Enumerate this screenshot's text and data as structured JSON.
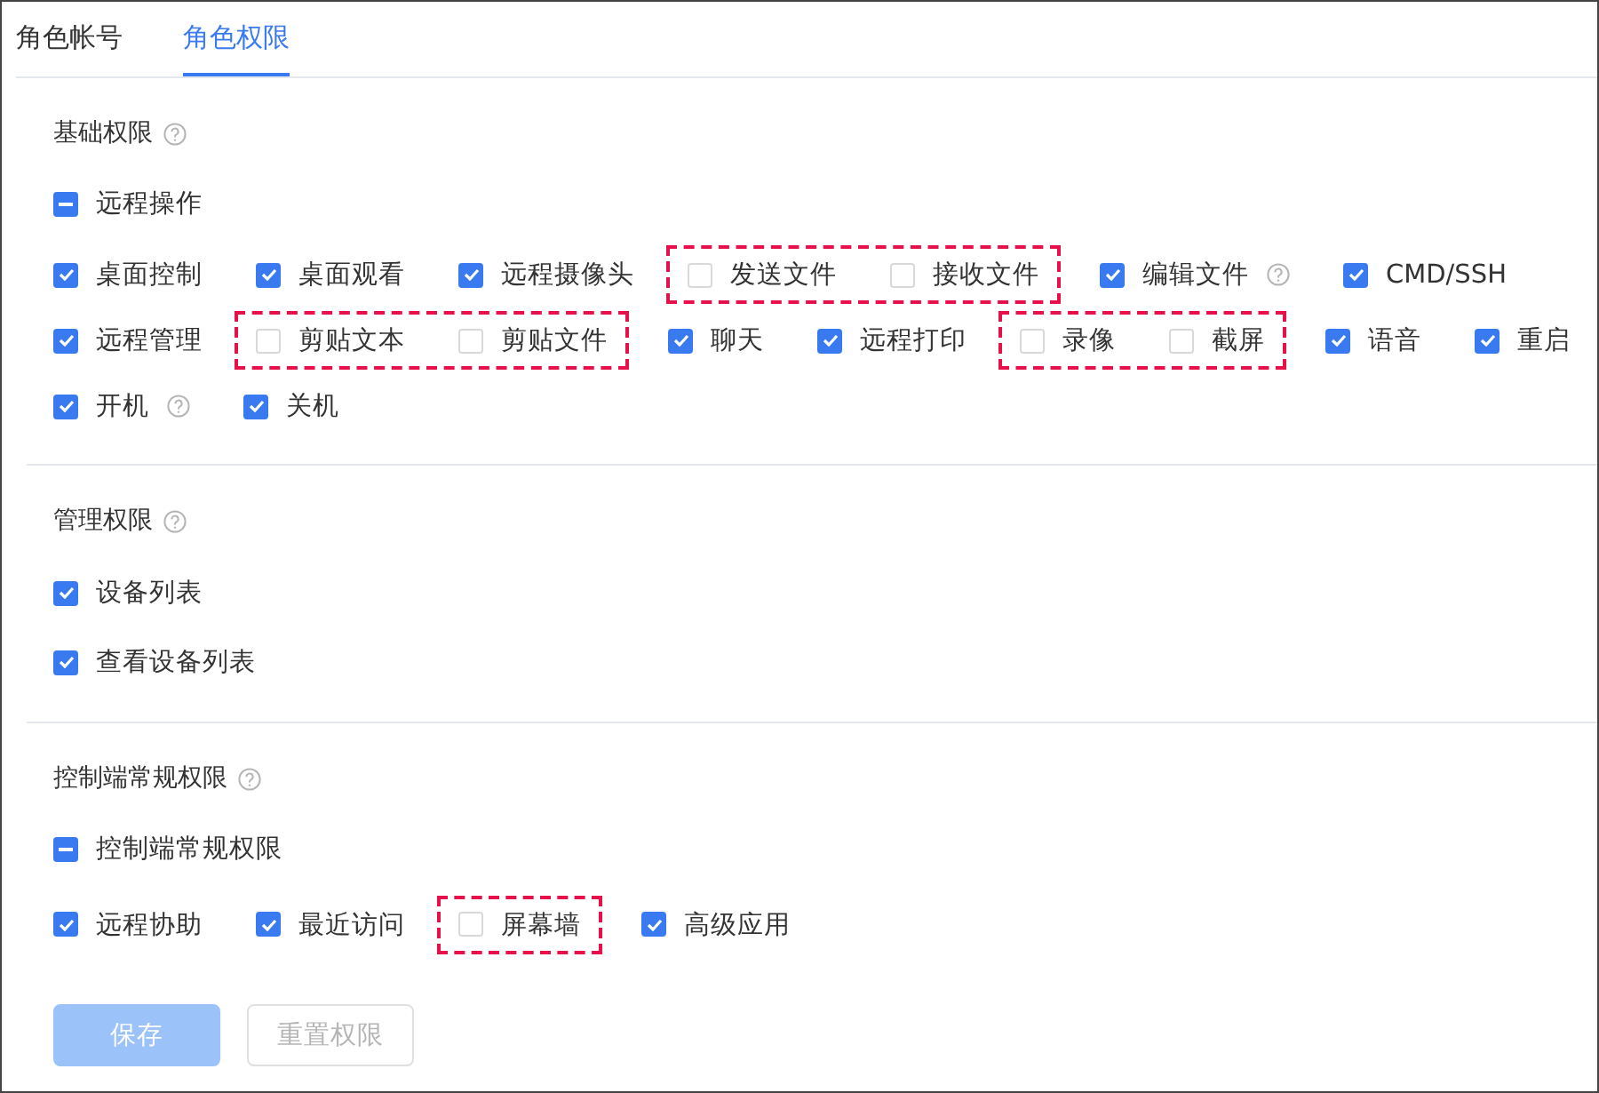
{
  "tabs": [
    {
      "label": "角色帐号",
      "selected": false
    },
    {
      "label": "角色权限",
      "selected": true
    }
  ],
  "sections": [
    {
      "title": "基础权限",
      "help": true,
      "kind": "wrapping",
      "parent": {
        "label": "远程操作",
        "indeterminate": true
      },
      "options": [
        {
          "kind": "item",
          "label": "桌面控制",
          "checked": true,
          "help": false
        },
        {
          "kind": "item",
          "label": "桌面观看",
          "checked": true,
          "help": false
        },
        {
          "kind": "item",
          "label": "远程摄像头",
          "checked": true,
          "help": false
        },
        {
          "kind": "marked-group",
          "items": [
            {
              "label": "发送文件",
              "checked": false,
              "help": false
            },
            {
              "label": "接收文件",
              "checked": false,
              "help": false
            }
          ]
        },
        {
          "kind": "item",
          "label": "编辑文件",
          "checked": true,
          "help": true
        },
        {
          "kind": "item",
          "label": "CMD/SSH",
          "checked": true,
          "help": false
        },
        {
          "kind": "item",
          "label": "远程管理",
          "checked": true,
          "help": false
        },
        {
          "kind": "marked-group",
          "items": [
            {
              "label": "剪贴文本",
              "checked": false,
              "help": false
            },
            {
              "label": "剪贴文件",
              "checked": false,
              "help": false
            }
          ]
        },
        {
          "kind": "item",
          "label": "聊天",
          "checked": true,
          "help": false
        },
        {
          "kind": "item",
          "label": "远程打印",
          "checked": true,
          "help": false
        },
        {
          "kind": "marked-group",
          "items": [
            {
              "label": "录像",
              "checked": false,
              "help": false
            },
            {
              "label": "截屏",
              "checked": false,
              "help": false
            }
          ]
        },
        {
          "kind": "item",
          "label": "语音",
          "checked": true,
          "help": false
        },
        {
          "kind": "item",
          "label": "重启",
          "checked": true,
          "help": false
        },
        {
          "kind": "item",
          "label": "开机",
          "checked": true,
          "help": true
        },
        {
          "kind": "item",
          "label": "关机",
          "checked": true,
          "help": false
        }
      ]
    },
    {
      "title": "管理权限",
      "help": true,
      "kind": "stacked",
      "options": [
        {
          "kind": "item",
          "label": "设备列表",
          "checked": true,
          "help": false
        },
        {
          "kind": "item",
          "label": "查看设备列表",
          "checked": true,
          "help": false
        }
      ]
    },
    {
      "title": "控制端常规权限",
      "help": true,
      "kind": "wrapping",
      "parent": {
        "label": "控制端常规权限",
        "indeterminate": true
      },
      "options": [
        {
          "kind": "item",
          "label": "远程协助",
          "checked": true,
          "help": false
        },
        {
          "kind": "item",
          "label": "最近访问",
          "checked": true,
          "help": false
        },
        {
          "kind": "marked-group",
          "items": [
            {
              "label": "屏幕墙",
              "checked": false,
              "help": false
            }
          ]
        },
        {
          "kind": "item",
          "label": "高级应用",
          "checked": true,
          "help": false
        }
      ]
    }
  ],
  "buttons": [
    {
      "label": "保存",
      "kind": "primary",
      "disabled": true
    },
    {
      "label": "重置权限",
      "kind": "secondary",
      "disabled": true
    }
  ]
}
